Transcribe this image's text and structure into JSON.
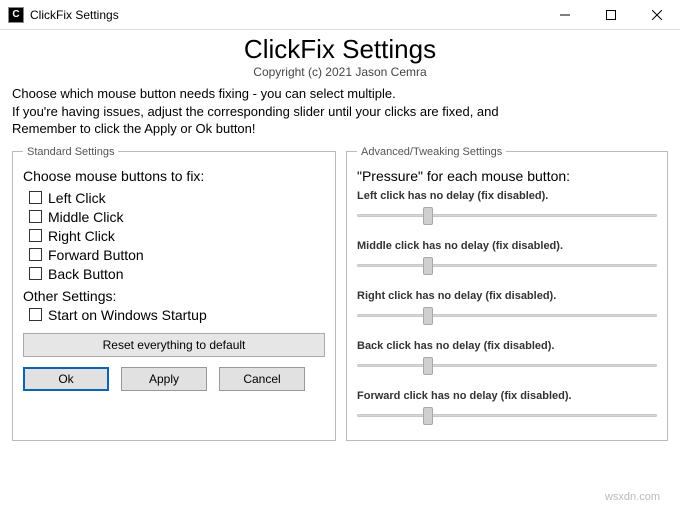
{
  "window": {
    "title": "ClickFix Settings"
  },
  "header": {
    "main_title": "ClickFix Settings",
    "copyright": "Copyright (c) 2021 Jason Cemra",
    "intro_line1": "Choose which mouse button needs fixing - you can select multiple.",
    "intro_line2": "If you're having issues, adjust the corresponding slider until your clicks are fixed, and",
    "intro_line3": "Remember to click the Apply or Ok button!"
  },
  "standard": {
    "legend": "Standard Settings",
    "choose_label": "Choose mouse buttons to fix:",
    "options": {
      "left": "Left Click",
      "middle": "Middle Click",
      "right": "Right Click",
      "forward": "Forward Button",
      "back": "Back Button"
    },
    "other_label": "Other Settings:",
    "startup": "Start on Windows Startup",
    "reset_label": "Reset everything to default"
  },
  "advanced": {
    "legend": "Advanced/Tweaking Settings",
    "pressure_label": "\"Pressure\" for each mouse button:",
    "sliders": {
      "left": "Left click has no delay (fix disabled).",
      "middle": "Middle click has no delay (fix disabled).",
      "right": "Right click has no delay (fix disabled).",
      "back": "Back click has no delay (fix disabled).",
      "forward": "Forward click has no delay (fix disabled)."
    }
  },
  "buttons": {
    "ok": "Ok",
    "apply": "Apply",
    "cancel": "Cancel"
  },
  "watermark": "wsxdn.com"
}
